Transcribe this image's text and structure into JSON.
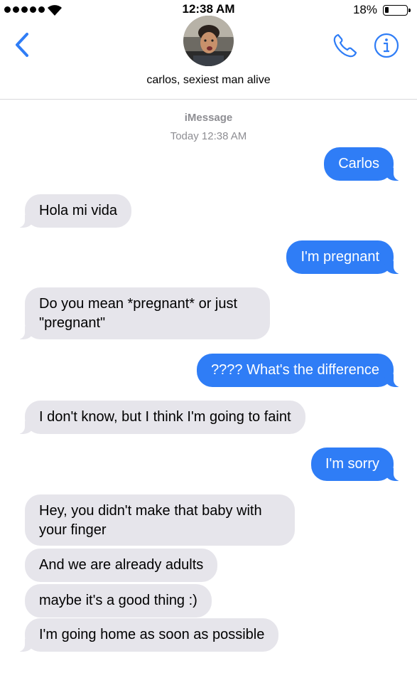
{
  "status_bar": {
    "time": "12:38 AM",
    "battery": "18%"
  },
  "header": {
    "contact_name": "carlos, sexiest man alive"
  },
  "thread": {
    "service": "iMessage",
    "timestamp": "Today 12:38 AM"
  },
  "messages": [
    {
      "from": "me",
      "text": "Carlos"
    },
    {
      "from": "them",
      "text": "Hola mi vida"
    },
    {
      "from": "me",
      "text": "I'm pregnant"
    },
    {
      "from": "them",
      "text": "Do you mean *pregnant* or just \"pregnant\""
    },
    {
      "from": "me",
      "text": "???? What's the difference"
    },
    {
      "from": "them",
      "text": "I don't know, but I think I'm going to faint"
    },
    {
      "from": "me",
      "text": "I'm sorry"
    },
    {
      "from": "them",
      "text": "Hey, you didn't make that baby with your finger"
    },
    {
      "from": "them",
      "text": "And we are already adults"
    },
    {
      "from": "them",
      "text": "maybe it's a good thing :)"
    },
    {
      "from": "them",
      "text": "I'm going home as soon as possible"
    }
  ],
  "colors": {
    "accent": "#2f7df6",
    "incoming_bubble": "#e6e5eb",
    "meta_text": "#8e8e93"
  },
  "icons": [
    "back-chevron-icon",
    "phone-icon",
    "info-icon",
    "wifi-icon",
    "battery-icon"
  ]
}
